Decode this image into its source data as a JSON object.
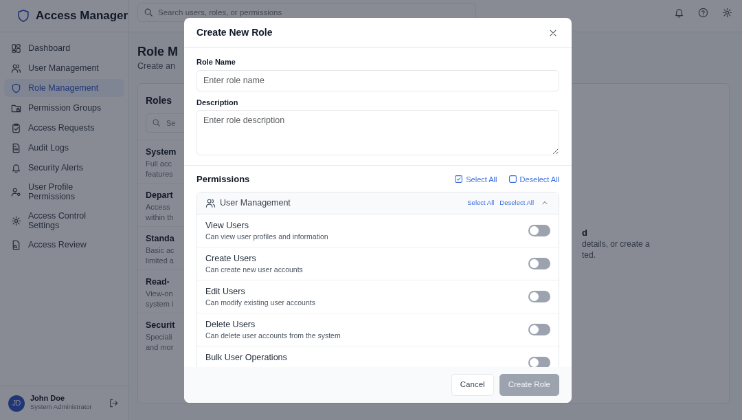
{
  "app": {
    "title": "Access Manager"
  },
  "search": {
    "placeholder": "Search users, roles, or permissions"
  },
  "sidebar": {
    "items": [
      {
        "label": "Dashboard",
        "selected": false
      },
      {
        "label": "User Management",
        "selected": false
      },
      {
        "label": "Role Management",
        "selected": true
      },
      {
        "label": "Permission Groups",
        "selected": false
      },
      {
        "label": "Access Requests",
        "selected": false
      },
      {
        "label": "Audit Logs",
        "selected": false
      },
      {
        "label": "Security Alerts",
        "selected": false
      },
      {
        "label": "User Profile Permissions",
        "selected": false
      },
      {
        "label": "Access Control Settings",
        "selected": false
      },
      {
        "label": "Access Review",
        "selected": false
      }
    ]
  },
  "user": {
    "initials": "JD",
    "name": "John Doe",
    "role": "System Administrator"
  },
  "page": {
    "title": "Role M",
    "subtitle": "Create an"
  },
  "roles_panel": {
    "title": "Roles",
    "search_placeholder": "Se",
    "roles": [
      {
        "name": "System",
        "description_lines": [
          "Full acc",
          "features"
        ]
      },
      {
        "name": "Depart",
        "description_lines": [
          "Access",
          "within th"
        ]
      },
      {
        "name": "Standa",
        "description_lines": [
          "Basic ac",
          "limited a"
        ]
      },
      {
        "name": "Read-",
        "description_lines": [
          "View-on",
          "system i"
        ]
      },
      {
        "name": "Securit",
        "description_lines": [
          "Speciali",
          "and mor"
        ]
      }
    ]
  },
  "detail": {
    "title": "d",
    "lines": [
      "details, or create a",
      "ted."
    ]
  },
  "modal": {
    "title": "Create New Role",
    "fields": [
      {
        "kind": "input",
        "label": "Role Name",
        "placeholder": "Enter role name"
      },
      {
        "kind": "textarea",
        "label": "Description",
        "placeholder": "Enter role description"
      }
    ],
    "permissions": {
      "title": "Permissions",
      "select_all": "Select All",
      "deselect_all": "Deselect All",
      "groups": [
        {
          "name": "User Management",
          "select_all": "Select All",
          "deselect_all": "Deselect All",
          "expanded": true,
          "items": [
            {
              "name": "View Users",
              "description": "Can view user profiles and information",
              "on": false
            },
            {
              "name": "Create Users",
              "description": "Can create new user accounts",
              "on": false
            },
            {
              "name": "Edit Users",
              "description": "Can modify existing user accounts",
              "on": false
            },
            {
              "name": "Delete Users",
              "description": "Can delete user accounts from the system",
              "on": false
            },
            {
              "name": "Bulk User Operations",
              "on": false
            }
          ]
        }
      ]
    },
    "buttons": [
      {
        "label": "Cancel",
        "kind": "secondary",
        "disabled": false
      },
      {
        "label": "Create Role",
        "kind": "primary",
        "disabled": true
      }
    ]
  }
}
